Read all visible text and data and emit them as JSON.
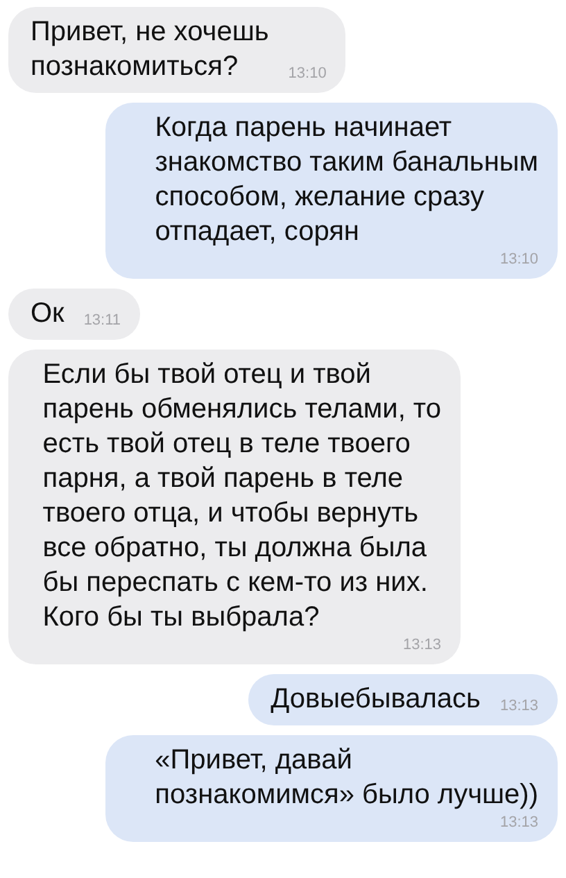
{
  "messages": [
    {
      "kind": "incoming",
      "text": "Привет, не хочешь\nпознакомиться?",
      "time": "13:10"
    },
    {
      "kind": "outgoing",
      "text": "Когда парень начинает\nзнакомство таким банальным\nспособом, желание сразу\nотпадает, сорян",
      "time": "13:10"
    },
    {
      "kind": "incoming",
      "text": "Ок",
      "time": "13:11"
    },
    {
      "kind": "incoming",
      "text": "Если бы твой отец и твой\nпарень обменялись телами, то\nесть твой отец в теле твоего\nпарня, а твой парень в теле\nтвоего отца, и чтобы вернуть\nвсе обратно, ты должна была\nбы переспать с кем-то из них.\nКого бы ты выбрала?",
      "time": "13:13"
    },
    {
      "kind": "outgoing",
      "text": "Довыебывалась",
      "time": "13:13"
    },
    {
      "kind": "outgoing",
      "text": "«Привет, давай\nпознакомимся» было лучше))",
      "time": "13:13"
    }
  ]
}
